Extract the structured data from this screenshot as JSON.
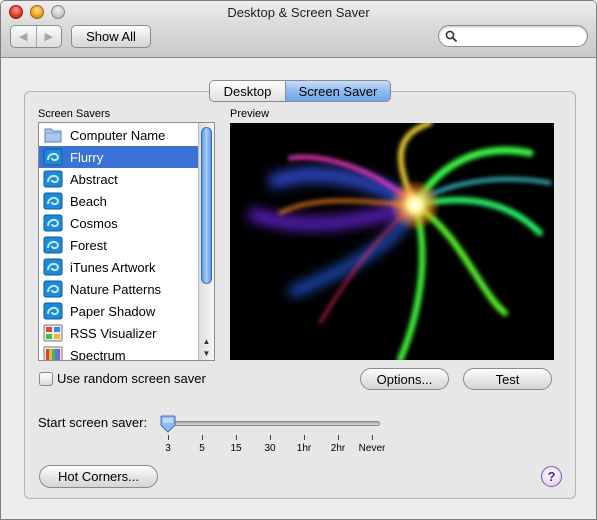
{
  "window": {
    "title": "Desktop & Screen Saver"
  },
  "toolbar": {
    "show_all_label": "Show All",
    "back_arrow": "◀",
    "forward_arrow": "▶"
  },
  "search": {
    "value": "",
    "placeholder": ""
  },
  "tabs": [
    {
      "label": "Desktop",
      "selected": false
    },
    {
      "label": "Screen Saver",
      "selected": true
    }
  ],
  "screen_savers": {
    "heading": "Screen Savers",
    "items": [
      {
        "label": "Computer Name",
        "icon": "folder-icon",
        "selected": false
      },
      {
        "label": "Flurry",
        "icon": "screensaver-swirl-icon",
        "selected": true
      },
      {
        "label": "Abstract",
        "icon": "screensaver-swirl-icon",
        "selected": false
      },
      {
        "label": "Beach",
        "icon": "screensaver-swirl-icon",
        "selected": false
      },
      {
        "label": "Cosmos",
        "icon": "screensaver-swirl-icon",
        "selected": false
      },
      {
        "label": "Forest",
        "icon": "screensaver-swirl-icon",
        "selected": false
      },
      {
        "label": "iTunes Artwork",
        "icon": "screensaver-swirl-icon",
        "selected": false
      },
      {
        "label": "Nature Patterns",
        "icon": "screensaver-swirl-icon",
        "selected": false
      },
      {
        "label": "Paper Shadow",
        "icon": "screensaver-swirl-icon",
        "selected": false
      },
      {
        "label": "RSS Visualizer",
        "icon": "rss-visualizer-icon",
        "selected": false
      },
      {
        "label": "Spectrum",
        "icon": "spectrum-icon",
        "selected": false
      }
    ]
  },
  "preview": {
    "heading": "Preview"
  },
  "random_checkbox": {
    "label": "Use random screen saver",
    "checked": false
  },
  "buttons": {
    "options": "Options...",
    "test": "Test",
    "hot_corners": "Hot Corners..."
  },
  "start_saver": {
    "label": "Start screen saver:",
    "ticks": [
      "3",
      "5",
      "15",
      "30",
      "1hr",
      "2hr",
      "Never"
    ],
    "selected": "3"
  },
  "help": {
    "label": "?"
  },
  "colors": {
    "selection": "#3b72d6",
    "tab_selected": "#8fbbef",
    "help_purple": "#4a2d86"
  }
}
